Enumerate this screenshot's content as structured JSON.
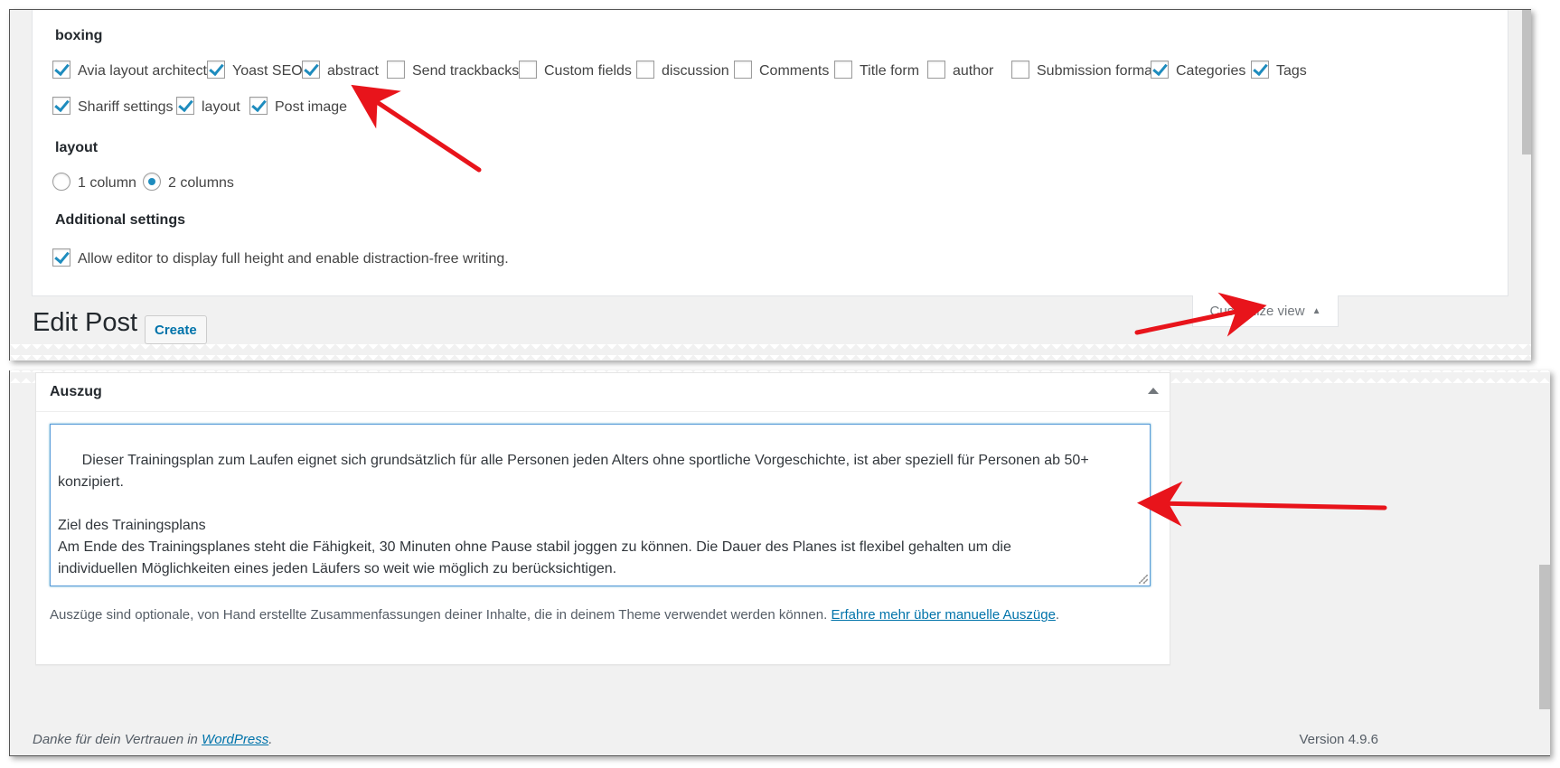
{
  "screen_options": {
    "boxing_title": "boxing",
    "boxes": [
      {
        "label": "Avia layout architect",
        "checked": true
      },
      {
        "label": "Yoast SEO",
        "checked": true
      },
      {
        "label": "abstract",
        "checked": true
      },
      {
        "label": "Send trackbacks",
        "checked": false
      },
      {
        "label": "Custom fields",
        "checked": false
      },
      {
        "label": "discussion",
        "checked": false
      },
      {
        "label": "Comments",
        "checked": false
      },
      {
        "label": "Title form",
        "checked": false
      },
      {
        "label": "author",
        "checked": false
      },
      {
        "label": "Submission format",
        "checked": false
      },
      {
        "label": "Categories",
        "checked": true
      },
      {
        "label": "Tags",
        "checked": true
      },
      {
        "label": "Shariff settings",
        "checked": true
      },
      {
        "label": "layout",
        "checked": true
      },
      {
        "label": "Post image",
        "checked": true
      }
    ],
    "layout_title": "layout",
    "layout_options": [
      {
        "label": "1 column",
        "checked": false
      },
      {
        "label": "2 columns",
        "checked": true
      }
    ],
    "additional_title": "Additional settings",
    "distraction_free": {
      "label": "Allow editor to display full height and enable distraction-free writing.",
      "checked": true
    },
    "customize_label": "Customize view"
  },
  "page": {
    "title": "Edit Post",
    "create_label": "Create"
  },
  "excerpt": {
    "title": "Auszug",
    "text": "Dieser Trainingsplan zum Laufen eignet sich grundsätzlich für alle Personen jeden Alters ohne sportliche Vorgeschichte, ist aber speziell für Personen ab 50+\nkonzipiert.\n\nZiel des Trainingsplans\nAm Ende des Trainingsplanes steht die Fähigkeit, 30 Minuten ohne Pause stabil joggen zu können. Die Dauer des Planes ist flexibel gehalten um die\nindividuellen Möglichkeiten eines jeden Läufers so weit wie möglich zu berücksichtigen.",
    "help_text": "Auszüge sind optionale, von Hand erstellte Zusammenfassungen deiner Inhalte, die in deinem Theme verwendet werden können.",
    "help_link": "Erfahre mehr über manuelle Auszüge",
    "help_end": "."
  },
  "footer": {
    "thanks_text": "Danke für dein Vertrauen in",
    "thanks_link": "WordPress",
    "thanks_end": ".",
    "version": "Version 4.9.6"
  },
  "colors": {
    "accent": "#1e8cbe",
    "link": "#0073aa",
    "annotation_arrow": "#e8141b",
    "admin_bg": "#f1f1f1"
  }
}
